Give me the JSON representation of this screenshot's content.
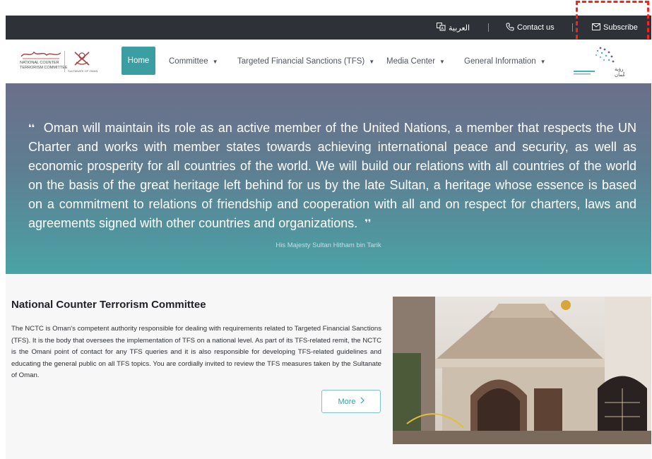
{
  "topbar": {
    "arabic_label": "العربية",
    "contact_label": "Contact us",
    "subscribe_label": "Subscribe"
  },
  "logo": {
    "org_name_line1": "NATIONAL COUNTER",
    "org_name_line2": "TERRORISM COMMITTEE",
    "ministry_text": "SULTANATE OF OMAN",
    "vision_text": "رؤية عُمان"
  },
  "nav": {
    "home": "Home",
    "committee": "Committee",
    "tfs": "Targeted Financial Sanctions (TFS)",
    "media": "Media Center",
    "general": "General Information"
  },
  "hero": {
    "quote": "Oman will maintain its role as an active member of the United Nations, a member that respects the UN Charter and works with member states towards achieving international peace and security, as well as economic prosperity for all countries of the world. We will build our relations with all countries of the world on the basis of the great heritage left behind for us by the late Sultan, a heritage whose essence is based on a commitment to relations of friendship and cooperation with all and on respect for charters, laws and agreements signed with other countries and organizations.",
    "attribution": "His Majesty Sultan Hitham bin Tarik"
  },
  "about": {
    "title": "National Counter Terrorism Committee",
    "description": "The NCTC is Oman's competent authority responsible for dealing with requirements related to Targeted Financial Sanctions (TFS). It is the body that oversees the implementation of TFS on a national level. As part of its TFS-related remit, the NCTC is the Omani point of contact for any TFS queries and it is also responsible for developing TFS-related guidelines and educating the general public on all TFS topics. You are cordially invited to review the TFS measures taken by the Sultanate of Oman.",
    "more_label": "More"
  },
  "colors": {
    "topbar_bg": "#2e3238",
    "accent": "#3a9ea3",
    "highlight": "#ff1f1f"
  }
}
